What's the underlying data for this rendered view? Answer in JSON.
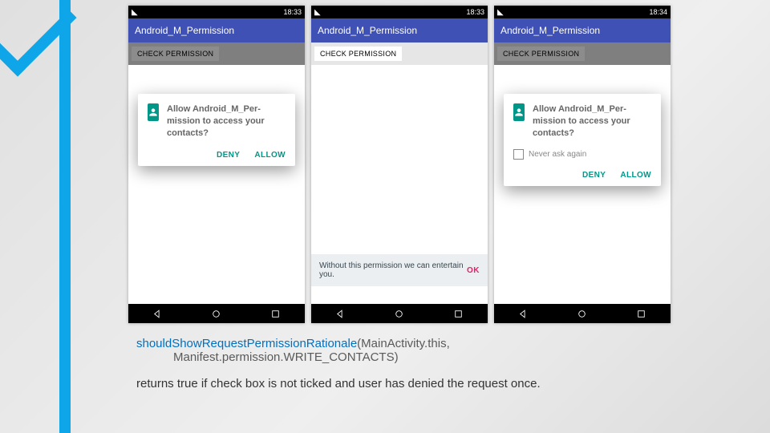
{
  "status": {
    "time1": "18:33",
    "time2": "18:33",
    "time3": "18:34"
  },
  "app": {
    "title": "Android_M_Permission"
  },
  "button": {
    "check": "CHECK PERMISSION"
  },
  "dialog": {
    "text": "Allow Android_M_Per-mission to access your contacts?",
    "deny": "DENY",
    "allow": "ALLOW",
    "neverask": "Never ask again"
  },
  "toast": {
    "msg": "Without this permission we can entertain you.",
    "ok": "OK"
  },
  "caption": {
    "method": "shouldShowRequestPermissionRationale",
    "args1": "(MainActivity.this,",
    "args2": "Manifest.permission.WRITE_CONTACTS)",
    "desc": "returns true if check box is not ticked and user has denied the request once."
  }
}
